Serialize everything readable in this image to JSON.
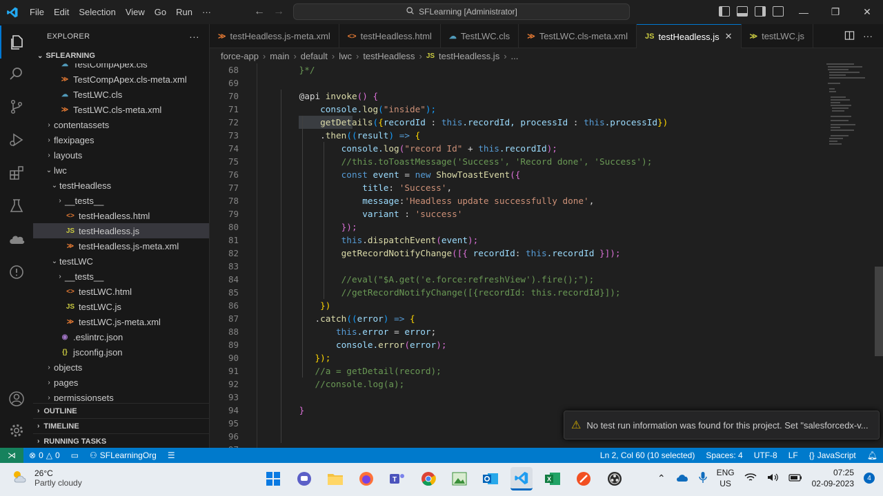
{
  "titlebar": {
    "menu": [
      "File",
      "Edit",
      "Selection",
      "View",
      "Go",
      "Run",
      "···"
    ],
    "search_text": "SFLearning [Administrator]"
  },
  "explorer": {
    "title": "EXPLORER",
    "more": "···",
    "root": "SFLEARNING",
    "tree": [
      {
        "label": "TestCompApex.cls",
        "icon": "apex-class-icon",
        "depth": 3,
        "chev": ""
      },
      {
        "label": "TestCompApex.cls-meta.xml",
        "icon": "xml-file-icon",
        "depth": 3,
        "chev": ""
      },
      {
        "label": "TestLWC.cls",
        "icon": "apex-class-icon",
        "depth": 3,
        "chev": ""
      },
      {
        "label": "TestLWC.cls-meta.xml",
        "icon": "xml-file-icon",
        "depth": 3,
        "chev": ""
      },
      {
        "label": "contentassets",
        "icon": "",
        "depth": 2,
        "chev": "›"
      },
      {
        "label": "flexipages",
        "icon": "",
        "depth": 2,
        "chev": "›"
      },
      {
        "label": "layouts",
        "icon": "",
        "depth": 2,
        "chev": "›"
      },
      {
        "label": "lwc",
        "icon": "",
        "depth": 2,
        "chev": "⌄"
      },
      {
        "label": "testHeadless",
        "icon": "",
        "depth": 3,
        "chev": "⌄"
      },
      {
        "label": "__tests__",
        "icon": "",
        "depth": 4,
        "chev": "›"
      },
      {
        "label": "testHeadless.html",
        "icon": "html-file-icon",
        "depth": 4,
        "chev": ""
      },
      {
        "label": "testHeadless.js",
        "icon": "js-file-icon",
        "depth": 4,
        "chev": "",
        "selected": true
      },
      {
        "label": "testHeadless.js-meta.xml",
        "icon": "xml-file-icon",
        "depth": 4,
        "chev": ""
      },
      {
        "label": "testLWC",
        "icon": "",
        "depth": 3,
        "chev": "⌄"
      },
      {
        "label": "__tests__",
        "icon": "",
        "depth": 4,
        "chev": "›"
      },
      {
        "label": "testLWC.html",
        "icon": "html-file-icon",
        "depth": 4,
        "chev": ""
      },
      {
        "label": "testLWC.js",
        "icon": "js-file-icon",
        "depth": 4,
        "chev": ""
      },
      {
        "label": "testLWC.js-meta.xml",
        "icon": "xml-file-icon",
        "depth": 4,
        "chev": ""
      },
      {
        "label": ".eslintrc.json",
        "icon": "eslint-file-icon",
        "depth": 3,
        "chev": ""
      },
      {
        "label": "jsconfig.json",
        "icon": "json-file-icon",
        "depth": 3,
        "chev": ""
      },
      {
        "label": "objects",
        "icon": "",
        "depth": 2,
        "chev": "›"
      },
      {
        "label": "pages",
        "icon": "",
        "depth": 2,
        "chev": "›"
      },
      {
        "label": "permissionsets",
        "icon": "",
        "depth": 2,
        "chev": "›"
      }
    ],
    "sections": [
      "OUTLINE",
      "TIMELINE",
      "RUNNING TASKS"
    ]
  },
  "tabs": [
    {
      "label": "testHeadless.js-meta.xml",
      "icon": "xml-file-icon",
      "glyph": "≫"
    },
    {
      "label": "testHeadless.html",
      "icon": "html-file-icon",
      "glyph": "<>"
    },
    {
      "label": "TestLWC.cls",
      "icon": "apex-class-icon",
      "glyph": "☁"
    },
    {
      "label": "TestLWC.cls-meta.xml",
      "icon": "xml-file-icon",
      "glyph": "≫"
    },
    {
      "label": "testHeadless.js",
      "icon": "js-file-icon",
      "glyph": "JS",
      "active": true
    },
    {
      "label": "testLWC.js",
      "icon": "js-file-icon",
      "glyph": "≫"
    }
  ],
  "breadcrumb": [
    "force-app",
    "main",
    "default",
    "lwc",
    "testHeadless",
    "testHeadless.js",
    "..."
  ],
  "code": {
    "line_numbers": [
      "68",
      "69",
      "70",
      "71",
      "72",
      "73",
      "74",
      "75",
      "76",
      "77",
      "78",
      "79",
      "80",
      "81",
      "82",
      "83",
      "84",
      "85",
      "86",
      "87",
      "88",
      "89",
      "90",
      "91",
      "92",
      "93",
      "94",
      "95",
      "96",
      "97"
    ],
    "lines": [
      [
        {
          "t": "    }*/",
          "c": "cm"
        }
      ],
      [],
      [
        {
          "t": "    ",
          "c": ""
        },
        {
          "t": "@api ",
          "c": ""
        },
        {
          "t": "invoke",
          "c": "fn"
        },
        {
          "t": "() ",
          "c": "br2"
        },
        {
          "t": "{",
          "c": "br2"
        }
      ],
      [
        {
          "t": "        console.",
          "c": "var"
        },
        {
          "t": "log",
          "c": "fn"
        },
        {
          "t": "(",
          "c": "br3"
        },
        {
          "t": "\"inside\"",
          "c": "str"
        },
        {
          "t": ");",
          "c": "br3"
        }
      ],
      [
        {
          "t": "        getDetails",
          "c": "fn"
        },
        {
          "t": "(",
          "c": "br3"
        },
        {
          "t": "{",
          "c": "br"
        },
        {
          "t": "recordId ",
          "c": "var"
        },
        {
          "t": ": ",
          "c": ""
        },
        {
          "t": "this",
          "c": "th"
        },
        {
          "t": ".recordId, ",
          "c": "var"
        },
        {
          "t": "processId ",
          "c": "var"
        },
        {
          "t": ": ",
          "c": ""
        },
        {
          "t": "this",
          "c": "th"
        },
        {
          "t": ".processId",
          "c": "var"
        },
        {
          "t": "})",
          "c": "br"
        }
      ],
      [
        {
          "t": "        .",
          "c": ""
        },
        {
          "t": "then",
          "c": "fn"
        },
        {
          "t": "((",
          "c": "br3"
        },
        {
          "t": "result",
          "c": "var"
        },
        {
          "t": ") ",
          "c": "br3"
        },
        {
          "t": "=> ",
          "c": "kw"
        },
        {
          "t": "{",
          "c": "br"
        }
      ],
      [
        {
          "t": "            console.",
          "c": "var"
        },
        {
          "t": "log",
          "c": "fn"
        },
        {
          "t": "(",
          "c": "br2"
        },
        {
          "t": "\"record Id\" ",
          "c": "str"
        },
        {
          "t": "+ ",
          "c": ""
        },
        {
          "t": "this",
          "c": "th"
        },
        {
          "t": ".recordId",
          "c": "var"
        },
        {
          "t": ");",
          "c": "br2"
        }
      ],
      [
        {
          "t": "            //this.toToastMessage('Success', 'Record done', 'Success');",
          "c": "cm"
        }
      ],
      [
        {
          "t": "            ",
          "c": ""
        },
        {
          "t": "const ",
          "c": "kw"
        },
        {
          "t": "event ",
          "c": "var"
        },
        {
          "t": "= ",
          "c": ""
        },
        {
          "t": "new ",
          "c": "kw"
        },
        {
          "t": "ShowToastEvent",
          "c": "fn"
        },
        {
          "t": "({",
          "c": "br2"
        }
      ],
      [
        {
          "t": "                title",
          "c": "var"
        },
        {
          "t": ": ",
          "c": ""
        },
        {
          "t": "'Success'",
          "c": "str"
        },
        {
          "t": ",",
          "c": ""
        }
      ],
      [
        {
          "t": "                message",
          "c": "var"
        },
        {
          "t": ":",
          "c": ""
        },
        {
          "t": "'Headless update successfully done'",
          "c": "str"
        },
        {
          "t": ",",
          "c": ""
        }
      ],
      [
        {
          "t": "                variant ",
          "c": "var"
        },
        {
          "t": ": ",
          "c": ""
        },
        {
          "t": "'success'",
          "c": "str"
        }
      ],
      [
        {
          "t": "            ",
          "c": ""
        },
        {
          "t": "});",
          "c": "br2"
        }
      ],
      [
        {
          "t": "            ",
          "c": ""
        },
        {
          "t": "this",
          "c": "th"
        },
        {
          "t": ".",
          "c": ""
        },
        {
          "t": "dispatchEvent",
          "c": "fn"
        },
        {
          "t": "(",
          "c": "br2"
        },
        {
          "t": "event",
          "c": "var"
        },
        {
          "t": ");",
          "c": "br2"
        }
      ],
      [
        {
          "t": "            ",
          "c": ""
        },
        {
          "t": "getRecordNotifyChange",
          "c": "fn"
        },
        {
          "t": "([{ ",
          "c": "br2"
        },
        {
          "t": "recordId",
          "c": "var"
        },
        {
          "t": ": ",
          "c": ""
        },
        {
          "t": "this",
          "c": "th"
        },
        {
          "t": ".recordId ",
          "c": "var"
        },
        {
          "t": "}]);",
          "c": "br2"
        }
      ],
      [],
      [
        {
          "t": "            //eval(\"$A.get('e.force:refreshView').fire();\");",
          "c": "cm"
        }
      ],
      [
        {
          "t": "            //getRecordNotifyChange([{recordId: this.recordId}]);",
          "c": "cm"
        }
      ],
      [
        {
          "t": "        ",
          "c": ""
        },
        {
          "t": "})",
          "c": "br"
        }
      ],
      [
        {
          "t": "       .",
          "c": ""
        },
        {
          "t": "catch",
          "c": "fn"
        },
        {
          "t": "((",
          "c": "br3"
        },
        {
          "t": "error",
          "c": "var"
        },
        {
          "t": ") ",
          "c": "br3"
        },
        {
          "t": "=> ",
          "c": "kw"
        },
        {
          "t": "{",
          "c": "br"
        }
      ],
      [
        {
          "t": "           ",
          "c": ""
        },
        {
          "t": "this",
          "c": "th"
        },
        {
          "t": ".error ",
          "c": "var"
        },
        {
          "t": "= ",
          "c": ""
        },
        {
          "t": "error",
          "c": "var"
        },
        {
          "t": ";",
          "c": ""
        }
      ],
      [
        {
          "t": "           console.",
          "c": "var"
        },
        {
          "t": "error",
          "c": "fn"
        },
        {
          "t": "(",
          "c": "br2"
        },
        {
          "t": "error",
          "c": "var"
        },
        {
          "t": ");",
          "c": "br2"
        }
      ],
      [
        {
          "t": "       ",
          "c": ""
        },
        {
          "t": "});",
          "c": "br"
        }
      ],
      [
        {
          "t": "       //a = getDetail(record);",
          "c": "cm"
        }
      ],
      [
        {
          "t": "       //console.log(a);",
          "c": "cm"
        }
      ],
      [],
      [
        {
          "t": "    ",
          "c": ""
        },
        {
          "t": "}",
          "c": "br2"
        }
      ],
      [],
      [],
      []
    ]
  },
  "notification": {
    "text": "No test run information was found for this project. Set \"salesforcedx-v..."
  },
  "statusbar": {
    "remote": "⋊",
    "errors": "0",
    "warnings": "0",
    "org": "SFLearningOrg",
    "position": "Ln 2, Col 60 (10 selected)",
    "spaces": "Spaces: 4",
    "encoding": "UTF-8",
    "eol": "LF",
    "language": "JavaScript"
  },
  "taskbar": {
    "temp": "26°C",
    "weather": "Partly cloudy",
    "lang1": "ENG",
    "lang2": "US",
    "time": "07:25",
    "date": "02-09-2023",
    "notifications": "4"
  },
  "colors": {
    "accent": "#0078d4",
    "statusbar": "#007acc",
    "remote": "#16825d",
    "warning": "#cca700"
  }
}
